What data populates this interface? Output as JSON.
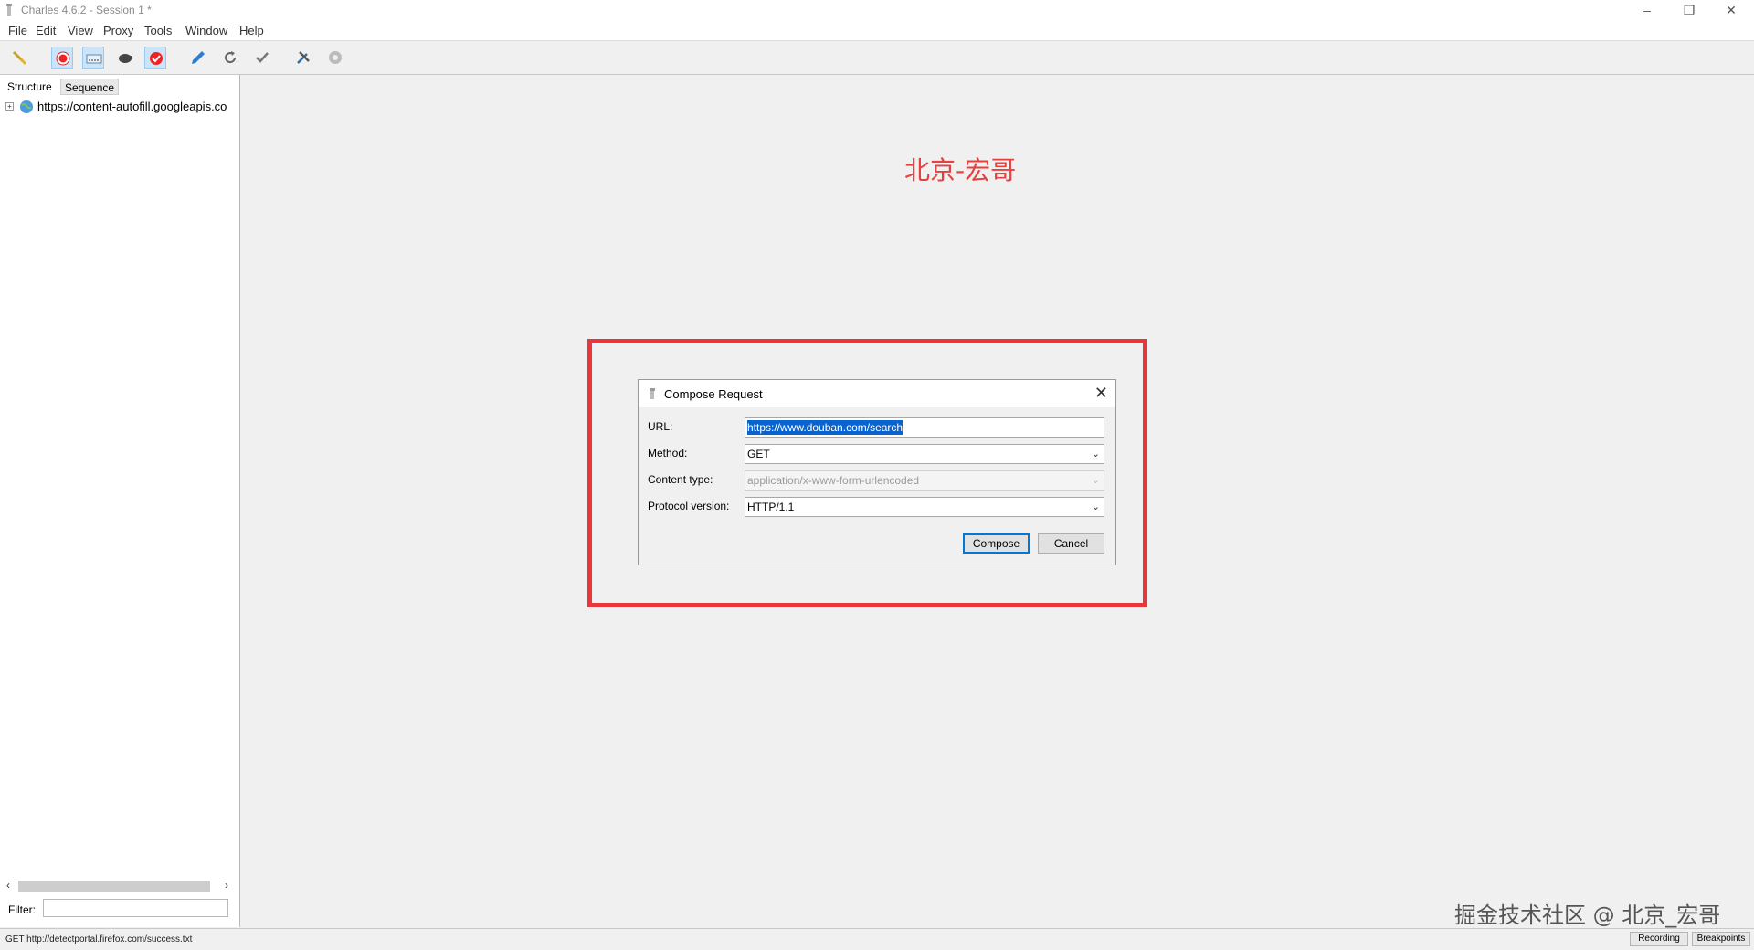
{
  "window": {
    "title": "Charles 4.6.2 - Session 1 *"
  },
  "menu": [
    "File",
    "Edit",
    "View",
    "Proxy",
    "Tools",
    "Window",
    "Help"
  ],
  "toolbar": {
    "buttons": [
      "broom-icon",
      "record-icon",
      "throttle-icon",
      "turtle-icon",
      "breakpoint-icon",
      "pen-icon",
      "refresh-icon",
      "check-icon",
      "tools-icon",
      "settings-icon"
    ]
  },
  "sidebar": {
    "tabs": [
      "Structure",
      "Sequence"
    ],
    "tree": [
      {
        "label": "https://content-autofill.googleapis.co"
      }
    ],
    "filter_label": "Filter:",
    "filter_value": ""
  },
  "watermark_top": "北京-宏哥",
  "dialog": {
    "title": "Compose Request",
    "url_label": "URL:",
    "url_value": "https://www.douban.com/search",
    "method_label": "Method:",
    "method_value": "GET",
    "content_type_label": "Content type:",
    "content_type_value": "application/x-www-form-urlencoded",
    "protocol_label": "Protocol version:",
    "protocol_value": "HTTP/1.1",
    "compose_button": "Compose",
    "cancel_button": "Cancel"
  },
  "watermark_bottom": "掘金技术社区 @ 北京_宏哥",
  "statusbar": {
    "text": "GET http://detectportal.firefox.com/success.txt",
    "recording": "Recording",
    "breakpoints": "Breakpoints"
  },
  "colors": {
    "highlight": "#e8363c",
    "watermark": "#e8403f",
    "selection": "#0a64d0"
  }
}
